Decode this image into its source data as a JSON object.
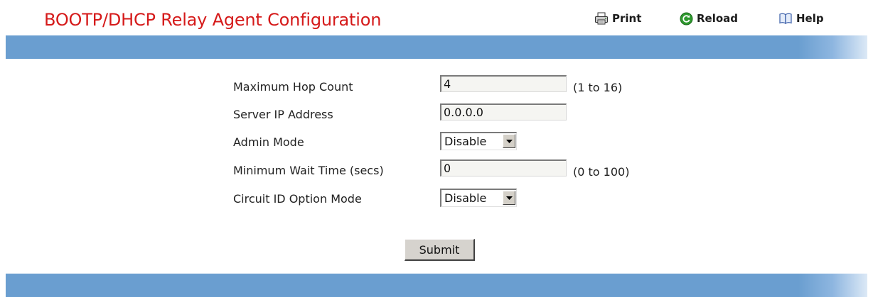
{
  "header": {
    "title": "BOOTP/DHCP Relay Agent Configuration",
    "print_label": "Print",
    "reload_label": "Reload",
    "help_label": "Help",
    "title_color": "#d51a1a",
    "bar_color": "#6a9ed0"
  },
  "form": {
    "max_hop_count": {
      "label": "Maximum Hop Count",
      "value": "4",
      "hint": "(1 to 16)"
    },
    "server_ip": {
      "label": "Server IP Address",
      "value": "0.0.0.0"
    },
    "admin_mode": {
      "label": "Admin Mode",
      "value": "Disable"
    },
    "min_wait_time": {
      "label": "Minimum Wait Time (secs)",
      "value": "0",
      "hint": "(0 to 100)"
    },
    "circuit_id_mode": {
      "label": "Circuit ID Option Mode",
      "value": "Disable"
    },
    "submit_label": "Submit"
  },
  "icons": {
    "print": "printer-icon",
    "reload": "reload-icon",
    "help": "help-book-icon",
    "dropdown": "chevron-down-icon"
  }
}
